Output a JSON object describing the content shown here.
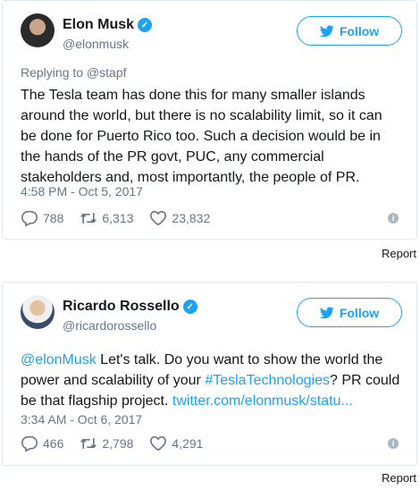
{
  "tweets": [
    {
      "name": "Elon Musk",
      "handle": "@elonmusk",
      "follow_label": "Follow",
      "replying_to": "Replying to @stapf",
      "text_lines": [
        "The Tesla team has done this for many smaller islands",
        "around the world, but there is no scalability limit, so it can",
        "be done for Puerto Rico too. Such a decision would be in",
        "the hands of the PR govt, PUC, any commercial",
        "stakeholders and, most importantly, the people of PR."
      ],
      "timestamp": "4:58 PM - Oct 5, 2017",
      "replies": "788",
      "retweets": "6,313",
      "likes": "23,832"
    },
    {
      "name": "Ricardo Rossello",
      "handle": "@ricardorossello",
      "follow_label": "Follow",
      "text": {
        "mention": "@elonMusk",
        "part1": " Let's talk. Do you want to show the world the",
        "part2": "power and scalability of your ",
        "hashtag": "#TeslaTechnologies",
        "part3": "? PR could",
        "part4": "be that flagship project. ",
        "url": "twitter.com/elonmusk/statu..."
      },
      "timestamp": "3:34 AM - Oct 6, 2017",
      "replies": "466",
      "retweets": "2,798",
      "likes": "4,291"
    }
  ],
  "report_label": "Report",
  "colors": {
    "accent": "#1da1f2",
    "secondary_text": "#657786",
    "border": "#e1e8ed"
  },
  "icons": [
    "verified-badge-icon",
    "twitter-bird-icon",
    "reply-icon",
    "retweet-icon",
    "like-icon",
    "info-icon"
  ]
}
